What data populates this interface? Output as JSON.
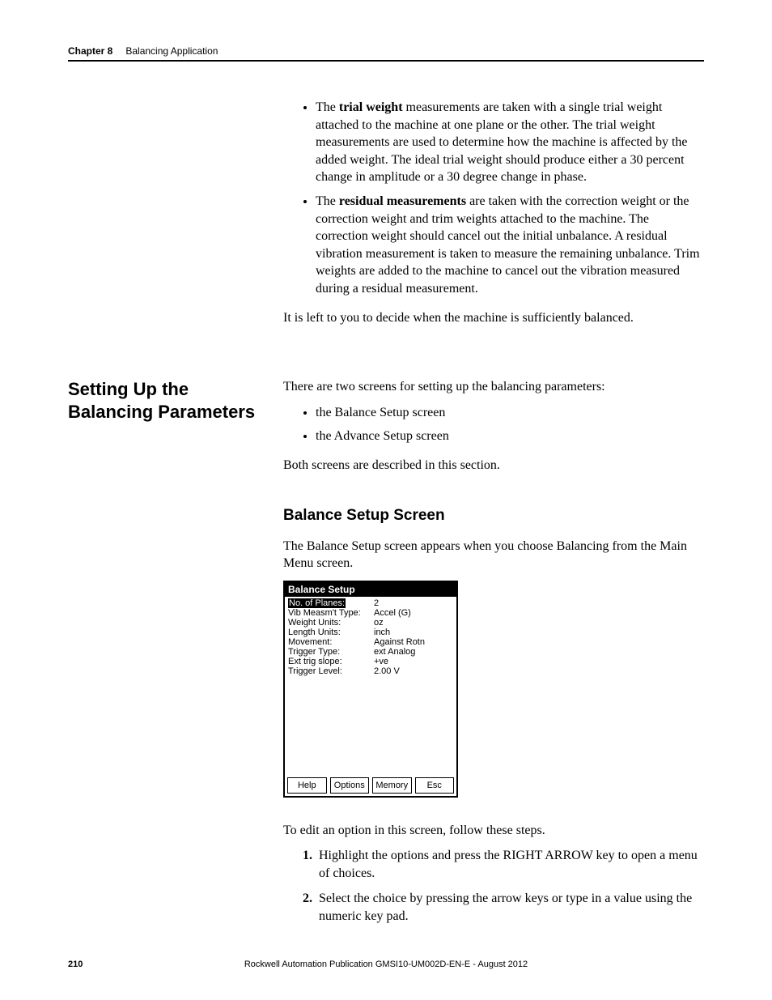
{
  "header": {
    "chapter_label": "Chapter 8",
    "chapter_title": "Balancing Application"
  },
  "bullets_top": [
    {
      "lead": "The ",
      "strong": "trial weight",
      "rest": " measurements are taken with a single trial weight attached to the machine at one plane or the other. The trial weight measurements are used to determine how the machine is affected by the added weight. The ideal trial weight should produce either a 30 percent change in amplitude or a 30 degree change in phase."
    },
    {
      "lead": "The ",
      "strong": "residual measurements",
      "rest": " are taken with the correction weight or the correction weight and trim weights attached to the machine. The correction weight should cancel out the initial unbalance. A residual vibration measurement is taken to measure the remaining unbalance. Trim weights are added to the machine to cancel out the vibration measured during a residual measurement."
    }
  ],
  "para_after_bullets": "It is left to you to decide when the machine is sufficiently balanced.",
  "section_heading": "Setting Up the Balancing Parameters",
  "setup_intro": "There are two screens for setting up the balancing parameters:",
  "setup_bullets": [
    "the Balance Setup screen",
    "the Advance Setup screen"
  ],
  "setup_after": "Both screens are described in this section.",
  "subsection_heading": "Balance Setup Screen",
  "subsection_intro": "The Balance Setup screen appears when you choose Balancing from the Main Menu screen.",
  "device": {
    "title": "Balance Setup",
    "rows": [
      {
        "label": "No. of Planes:",
        "value": "2",
        "selected": true
      },
      {
        "label": "Vib Measm't Type:",
        "value": "Accel (G)"
      },
      {
        "label": "Weight Units:",
        "value": "oz"
      },
      {
        "label": "Length Units:",
        "value": "inch"
      },
      {
        "label": "Movement:",
        "value": "Against Rotn"
      },
      {
        "label": "Trigger Type:",
        "value": "ext Analog"
      },
      {
        "label": "Ext trig slope:",
        "value": "+ve"
      },
      {
        "label": "Trigger Level:",
        "value": "2.00 V"
      }
    ],
    "softkeys": [
      "Help",
      "Options",
      "Memory",
      "Esc"
    ]
  },
  "edit_intro": "To edit an option in this screen, follow these steps.",
  "steps": [
    "Highlight the options and press the RIGHT ARROW key to open a menu of choices.",
    "Select the choice by pressing the arrow keys or type in a value using the numeric key pad."
  ],
  "footer": {
    "page_number": "210",
    "publication": "Rockwell Automation Publication GMSI10-UM002D-EN-E - August 2012"
  }
}
